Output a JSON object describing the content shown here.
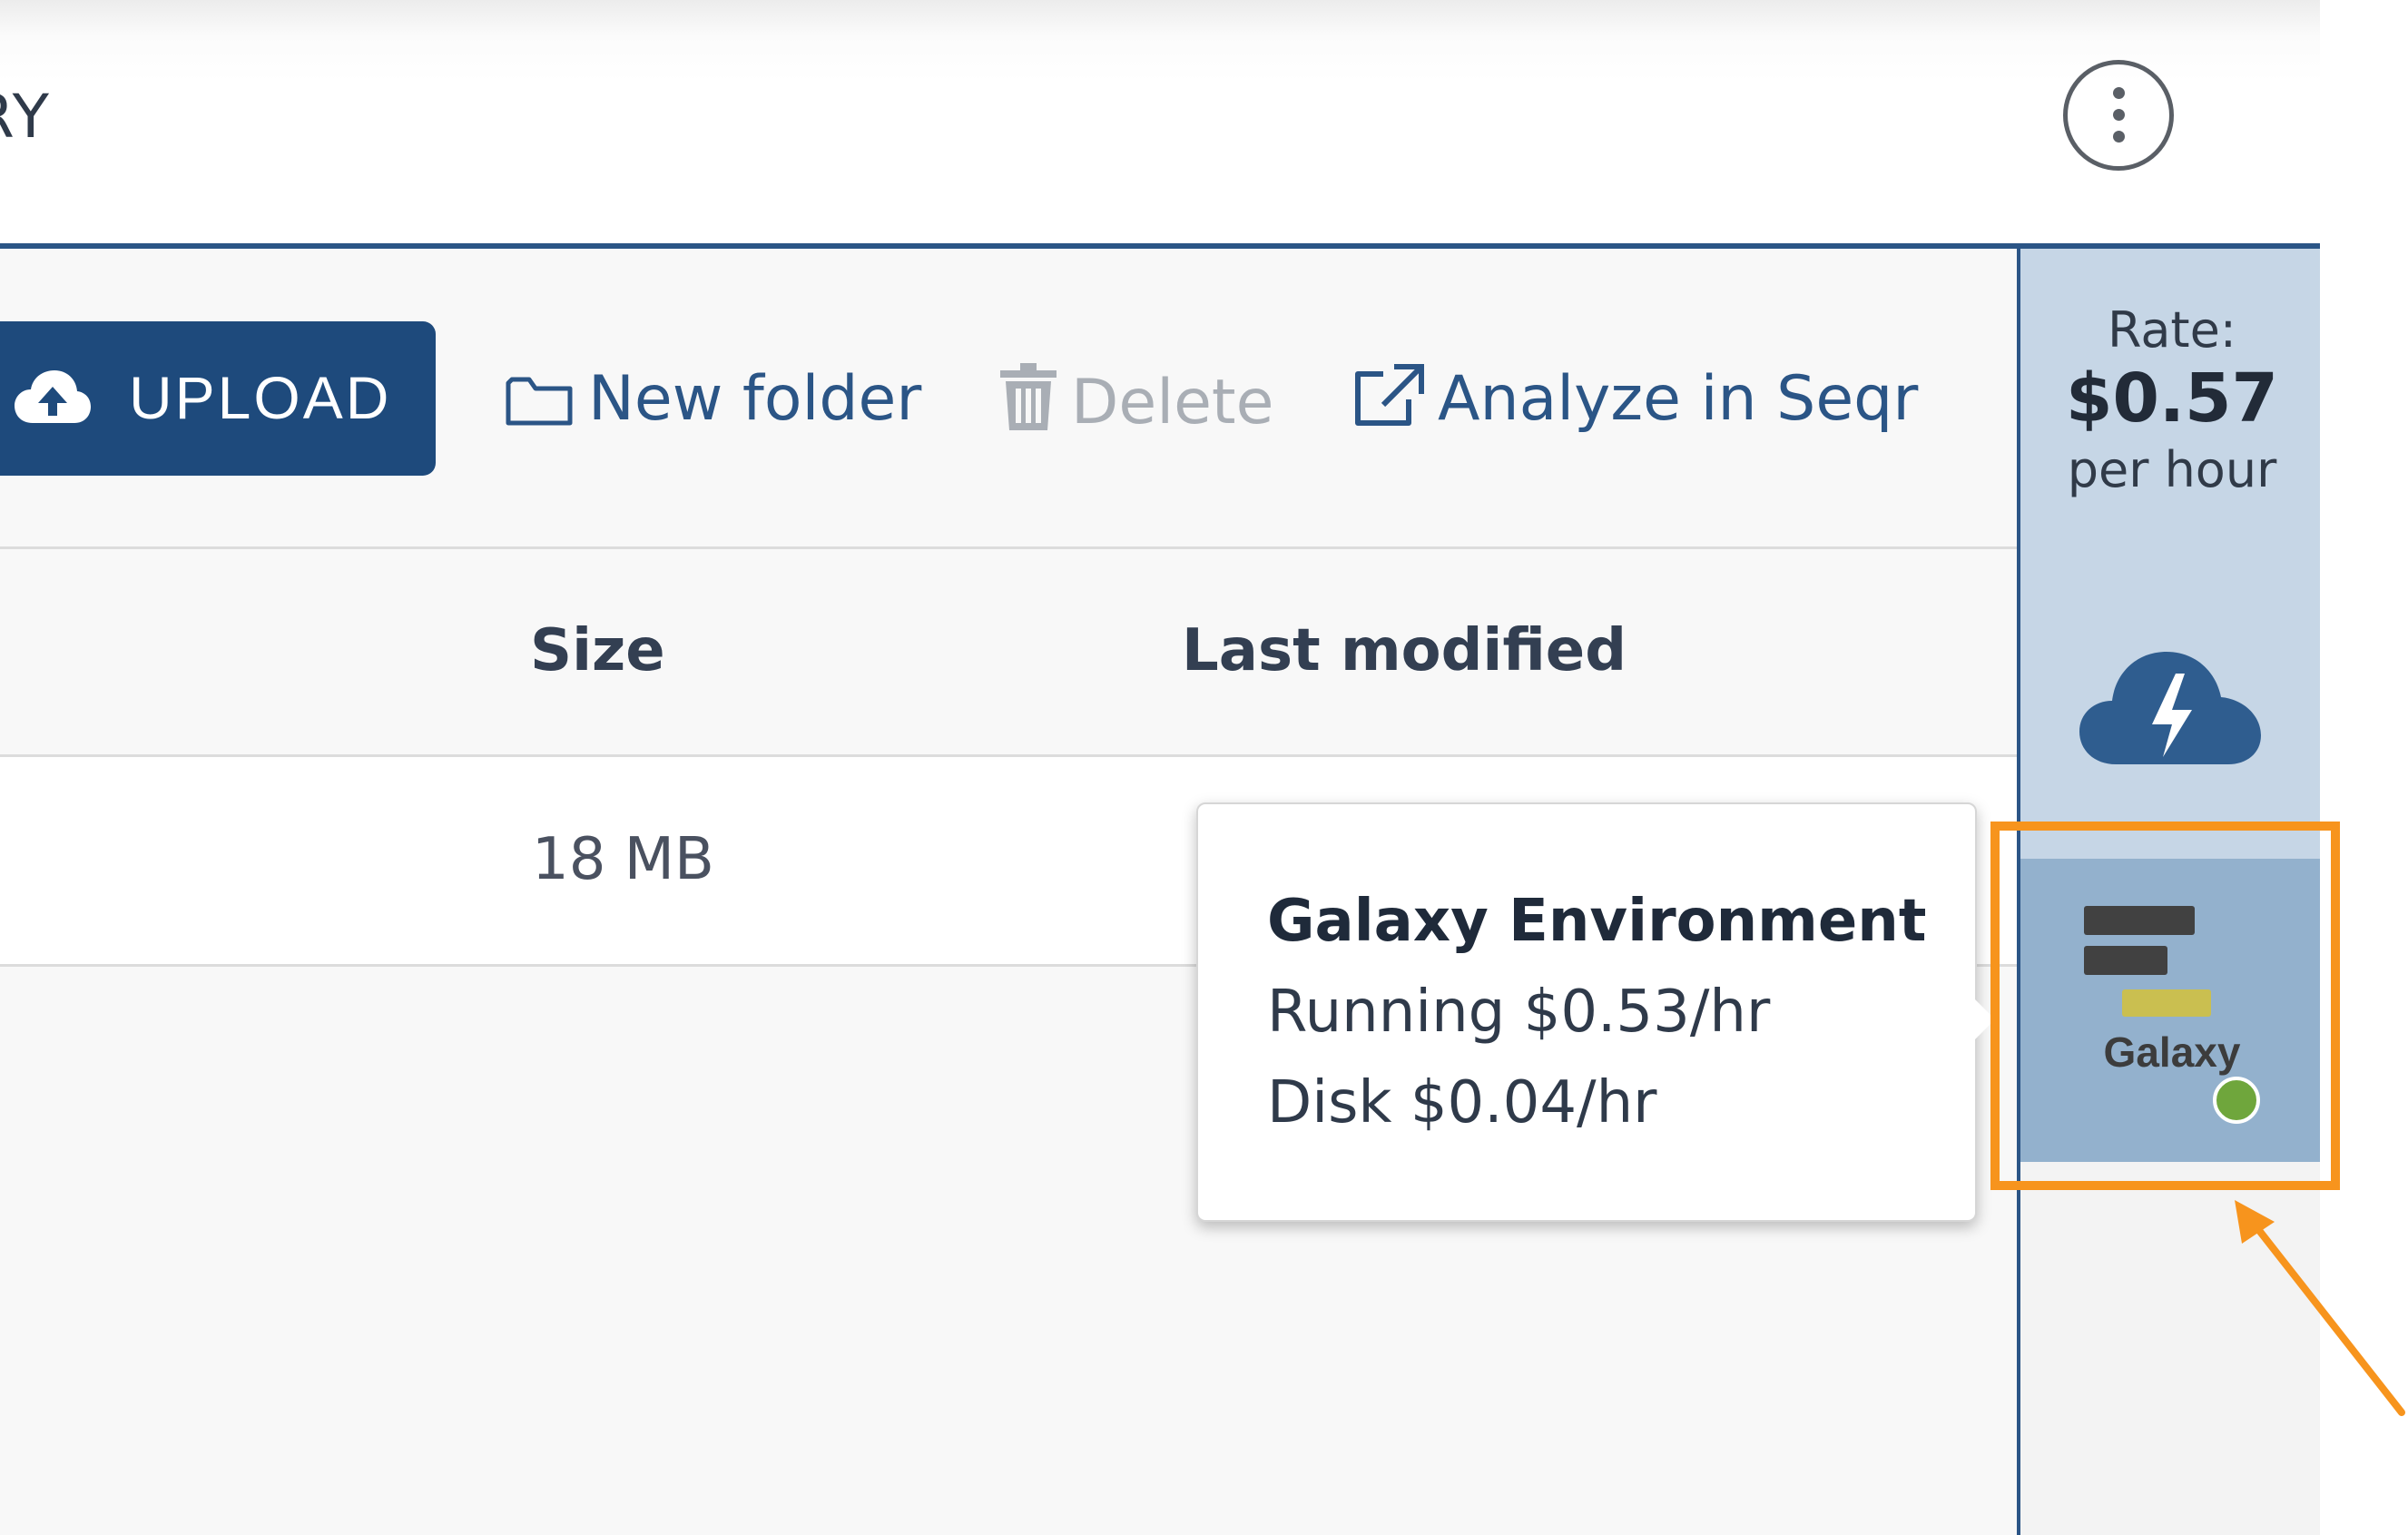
{
  "header": {
    "title_fragment": "RY"
  },
  "toolbar": {
    "upload_label": "UPLOAD",
    "new_folder_label": "New folder",
    "delete_label": "Delete",
    "analyze_label": "Analyze in Seqr"
  },
  "table": {
    "columns": [
      "Size",
      "Last modified"
    ],
    "rows": [
      {
        "size": "18 MB"
      }
    ]
  },
  "sidebar": {
    "rate_label": "Rate:",
    "rate_value": "$0.57",
    "rate_unit": "per hour",
    "galaxy_label": "Galaxy",
    "galaxy_status_color": "#6fa63c"
  },
  "tooltip": {
    "title": "Galaxy Environment",
    "running": "Running $0.53/hr",
    "disk": "Disk $0.04/hr"
  },
  "annotation": {
    "highlight_color": "#f7941d"
  },
  "colors": {
    "primary": "#1e4a7c",
    "accent_blue": "#2b5586",
    "disabled": "#a9aeb5"
  }
}
